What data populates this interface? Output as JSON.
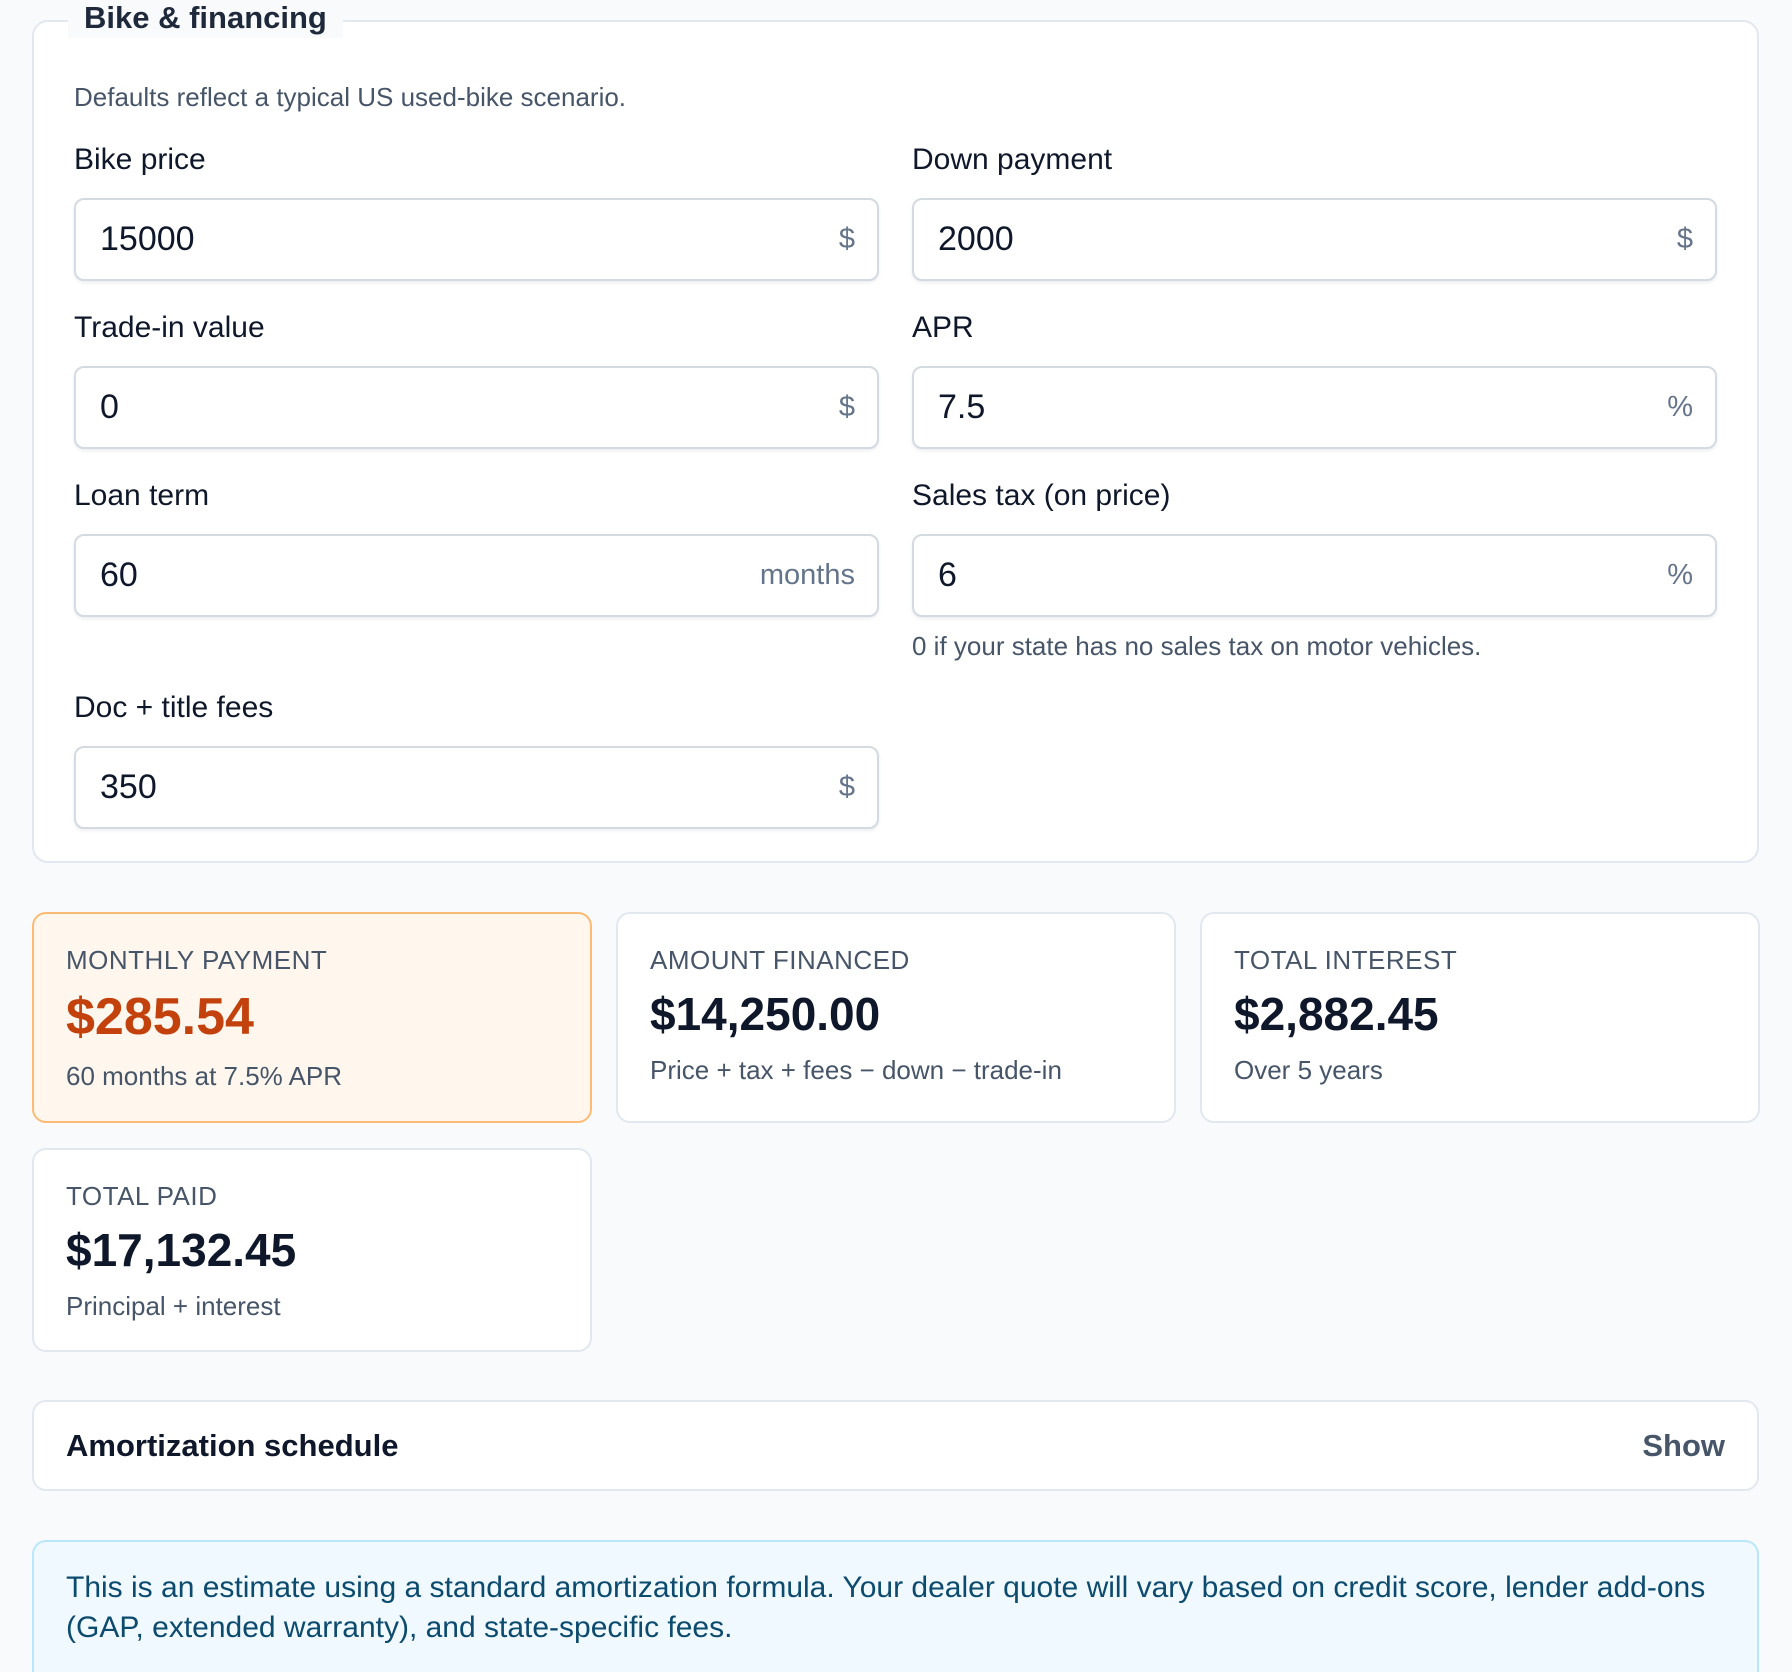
{
  "section": {
    "title": "Bike & financing",
    "hint": "Defaults reflect a typical US used-bike scenario."
  },
  "fields": {
    "bike_price": {
      "label": "Bike price",
      "value": "15000",
      "suffix": "$"
    },
    "down_payment": {
      "label": "Down payment",
      "value": "2000",
      "suffix": "$"
    },
    "trade_in": {
      "label": "Trade-in value",
      "value": "0",
      "suffix": "$"
    },
    "apr": {
      "label": "APR",
      "value": "7.5",
      "suffix": "%"
    },
    "loan_term": {
      "label": "Loan term",
      "value": "60",
      "suffix": "months"
    },
    "sales_tax": {
      "label": "Sales tax (on price)",
      "value": "6",
      "suffix": "%",
      "help": "0 if your state has no sales tax on motor vehicles."
    },
    "fees": {
      "label": "Doc + title fees",
      "value": "350",
      "suffix": "$"
    }
  },
  "results": {
    "monthly": {
      "label": "MONTHLY PAYMENT",
      "value": "$285.54",
      "sub": "60 months at 7.5% APR"
    },
    "financed": {
      "label": "AMOUNT FINANCED",
      "value": "$14,250.00",
      "sub": "Price + tax + fees − down − trade-in"
    },
    "interest": {
      "label": "TOTAL INTEREST",
      "value": "$2,882.45",
      "sub": "Over 5 years"
    },
    "total_paid": {
      "label": "TOTAL PAID",
      "value": "$17,132.45",
      "sub": "Principal + interest"
    }
  },
  "amortization": {
    "title": "Amortization schedule",
    "toggle_label": "Show"
  },
  "note": {
    "text": "This is an estimate using a standard amortization formula. Your dealer quote will vary based on credit score, lender add-ons (GAP, extended warranty), and state-specific fees."
  },
  "colors": {
    "accent": "#c2410c",
    "highlight_bg": "#fff7ed",
    "highlight_border": "#fdba74",
    "note_bg": "#f0f9ff",
    "note_border": "#bae6fd",
    "note_text": "#0c4a6e"
  }
}
